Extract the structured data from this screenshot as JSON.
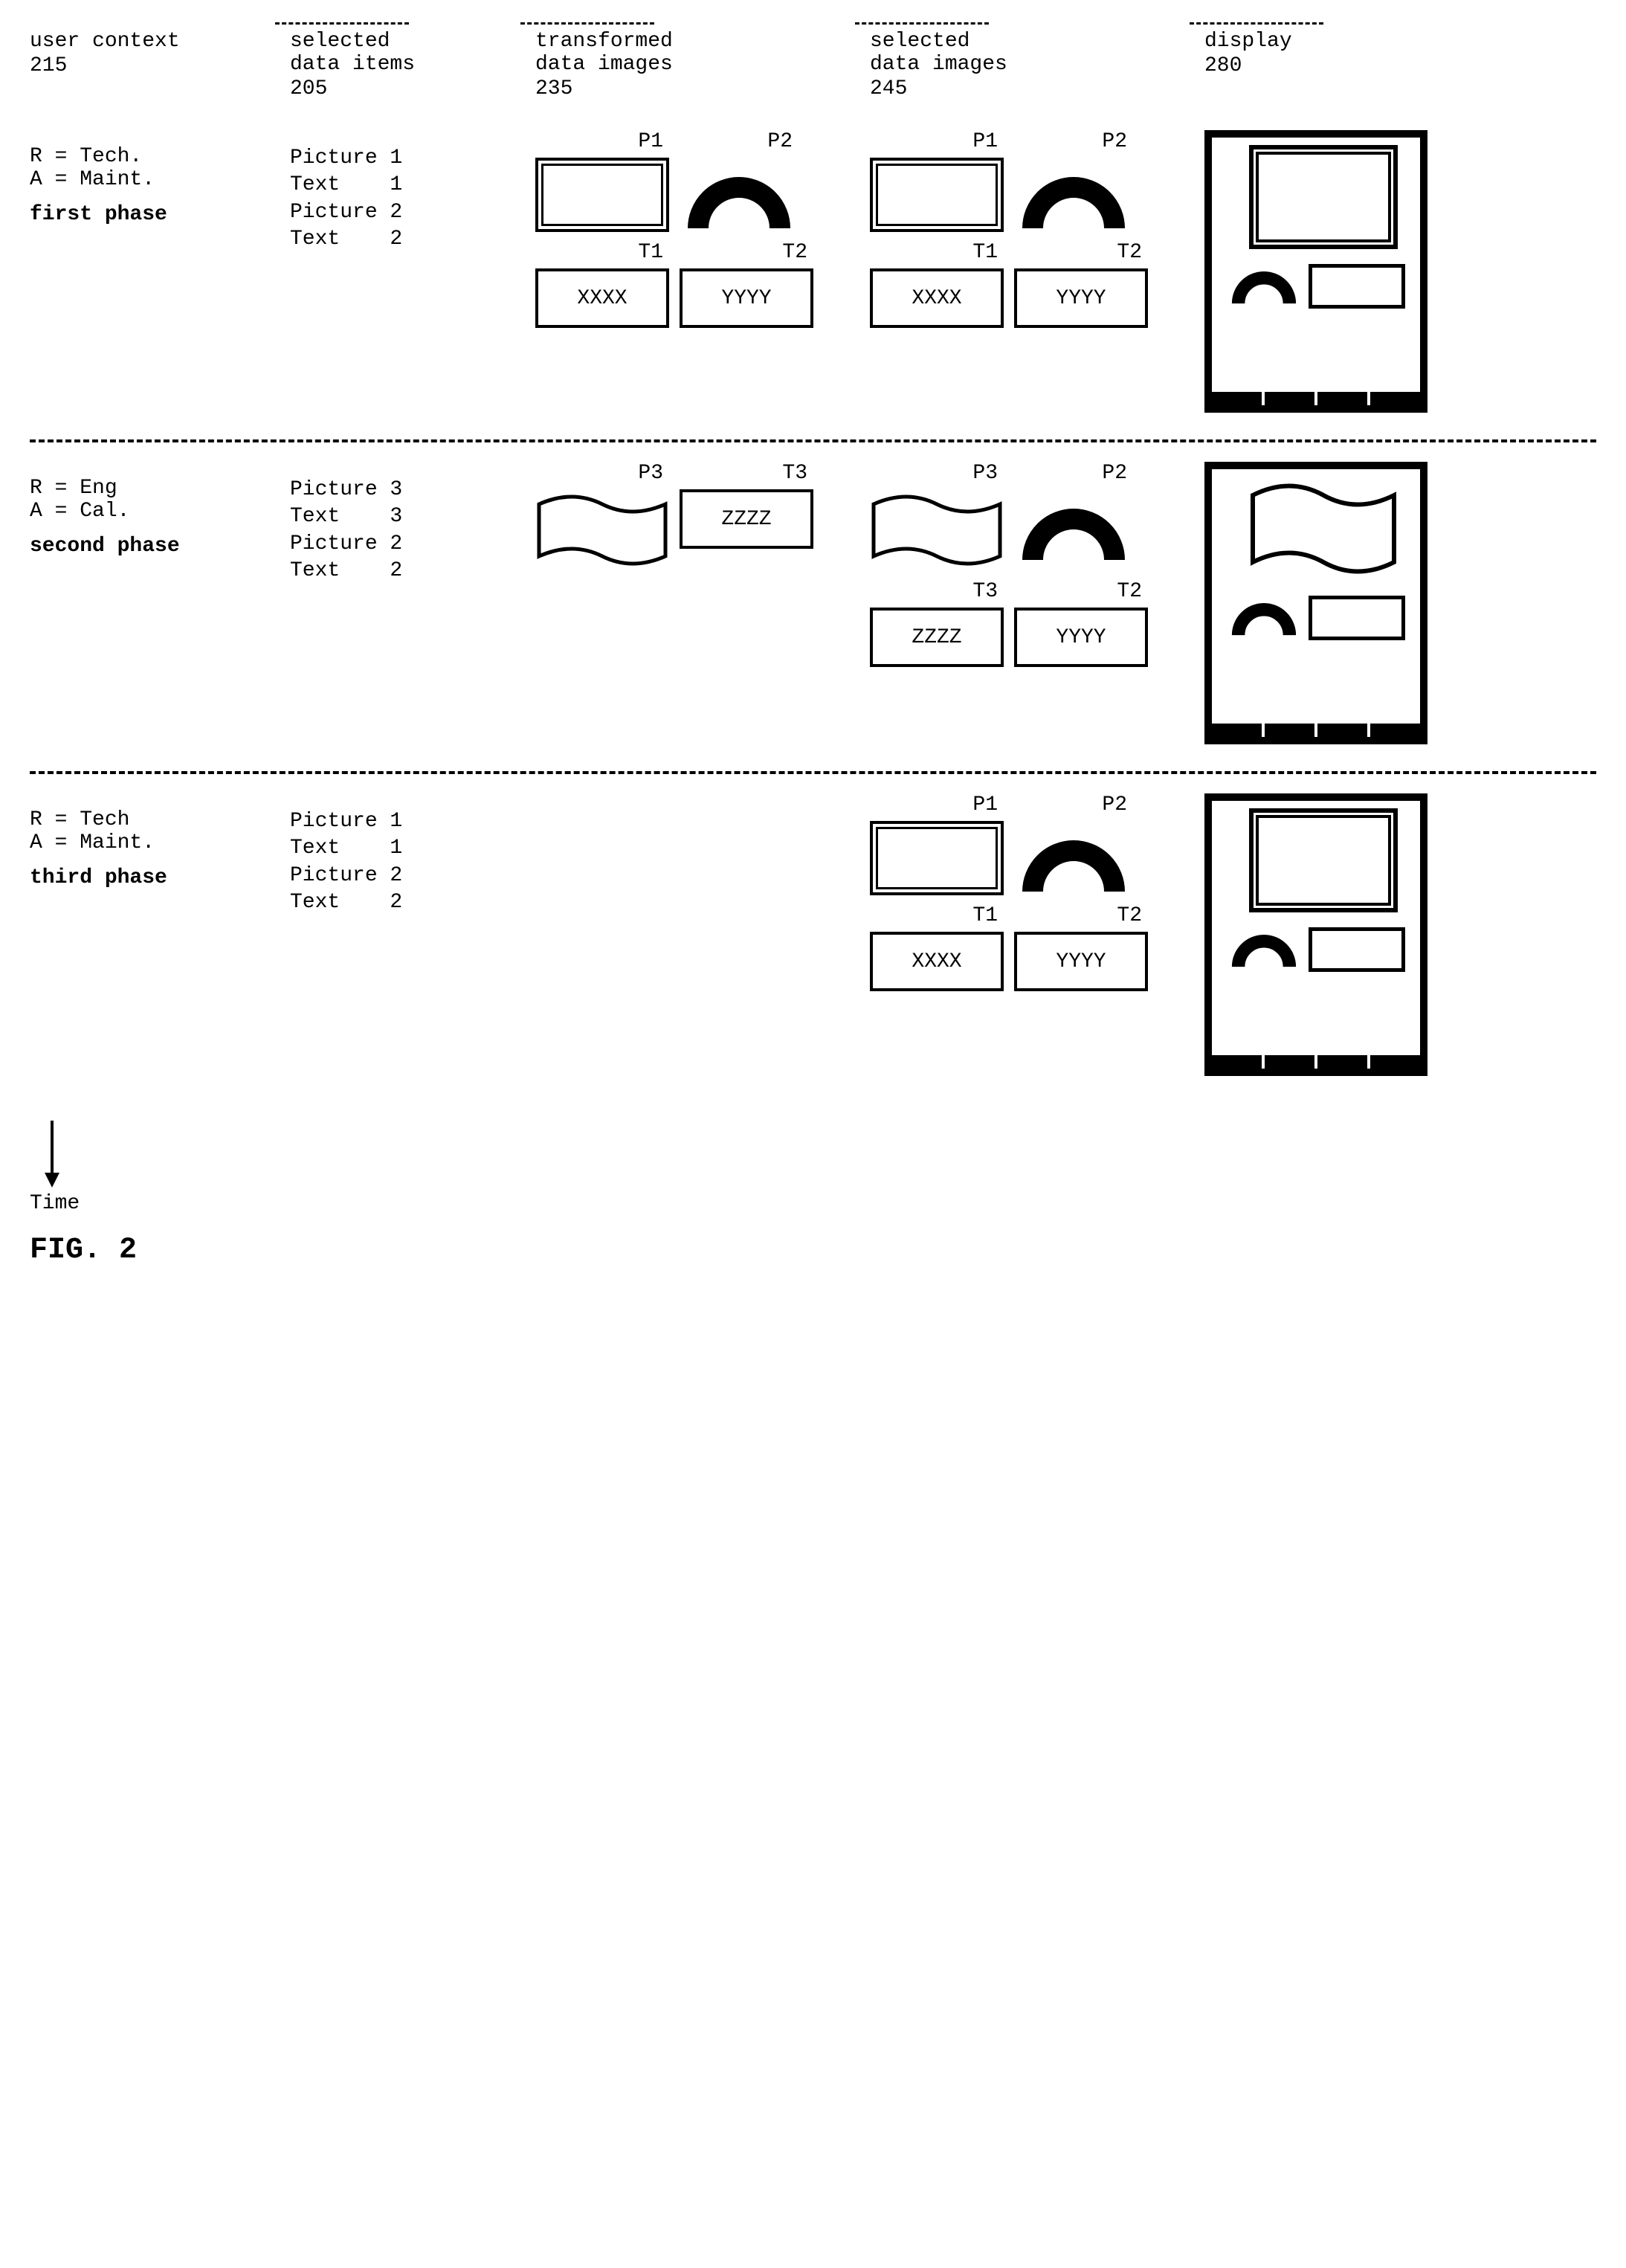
{
  "headers": {
    "col1": {
      "title": "user context",
      "ref": "215"
    },
    "col2": {
      "title_l1": "selected",
      "title_l2": "data items",
      "ref": "205"
    },
    "col3": {
      "title_l1": "transformed",
      "title_l2": "data images",
      "ref": "235"
    },
    "col4": {
      "title_l1": "selected",
      "title_l2": "data images",
      "ref": "245"
    },
    "col5": {
      "title": "display",
      "ref": "280"
    }
  },
  "phases": [
    {
      "id": "first",
      "label": "first phase",
      "context": [
        "R = Tech.",
        "A = Maint."
      ],
      "items": [
        "Picture 1",
        "Text    1",
        "Picture 2",
        "Text    2"
      ],
      "transformed": [
        {
          "label": "P1",
          "kind": "rect-dbl"
        },
        {
          "label": "P2",
          "kind": "arc"
        },
        {
          "label": "T1",
          "kind": "txt",
          "text": "XXXX"
        },
        {
          "label": "T2",
          "kind": "txt",
          "text": "YYYY"
        }
      ],
      "selected": [
        {
          "label": "P1",
          "kind": "rect-dbl"
        },
        {
          "label": "P2",
          "kind": "arc"
        },
        {
          "label": "T1",
          "kind": "txt",
          "text": "XXXX"
        },
        {
          "label": "T2",
          "kind": "txt",
          "text": "YYYY"
        }
      ],
      "display_main": "rect-dbl"
    },
    {
      "id": "second",
      "label": "second phase",
      "context": [
        "R = Eng",
        "A = Cal."
      ],
      "items": [
        "Picture 3",
        "Text    3",
        "Picture 2",
        "Text    2"
      ],
      "transformed": [
        {
          "label": "P3",
          "kind": "wavy"
        },
        {
          "label": "T3",
          "kind": "txt",
          "text": "ZZZZ"
        }
      ],
      "selected": [
        {
          "label": "P3",
          "kind": "wavy"
        },
        {
          "label": "P2",
          "kind": "arc"
        },
        {
          "label": "T3",
          "kind": "txt",
          "text": "ZZZZ"
        },
        {
          "label": "T2",
          "kind": "txt",
          "text": "YYYY"
        }
      ],
      "display_main": "wavy"
    },
    {
      "id": "third",
      "label": "third phase",
      "context": [
        "R = Tech",
        "A = Maint."
      ],
      "items": [
        "Picture 1",
        "Text    1",
        "Picture 2",
        "Text    2"
      ],
      "transformed": [],
      "selected": [
        {
          "label": "P1",
          "kind": "rect-dbl"
        },
        {
          "label": "P2",
          "kind": "arc"
        },
        {
          "label": "T1",
          "kind": "txt",
          "text": "XXXX"
        },
        {
          "label": "T2",
          "kind": "txt",
          "text": "YYYY"
        }
      ],
      "display_main": "rect-dbl"
    }
  ],
  "footer": {
    "time": "Time",
    "fig": "FIG. 2"
  }
}
